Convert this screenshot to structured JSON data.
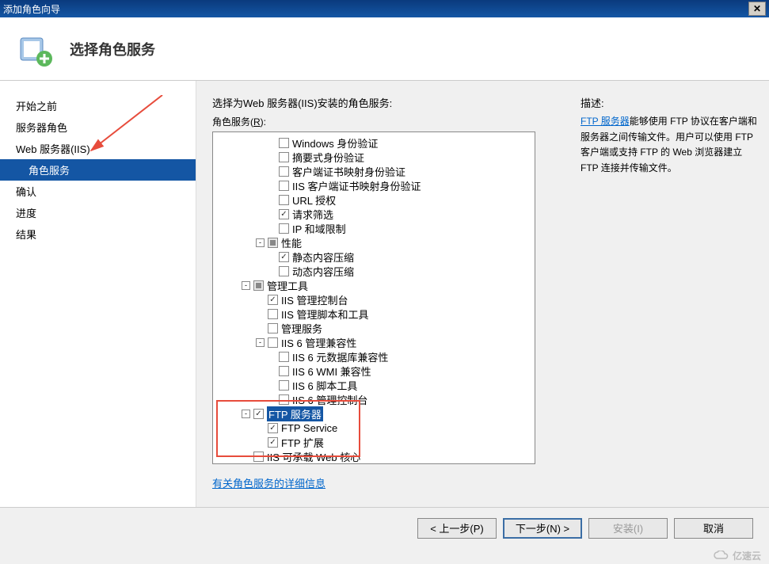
{
  "window": {
    "title": "添加角色向导"
  },
  "header": {
    "title": "选择角色服务"
  },
  "sidebar": {
    "items": [
      {
        "label": "开始之前",
        "indent": false,
        "selected": false
      },
      {
        "label": "服务器角色",
        "indent": false,
        "selected": false
      },
      {
        "label": "Web 服务器(IIS)",
        "indent": false,
        "selected": false
      },
      {
        "label": "角色服务",
        "indent": true,
        "selected": true
      },
      {
        "label": "确认",
        "indent": false,
        "selected": false
      },
      {
        "label": "进度",
        "indent": false,
        "selected": false
      },
      {
        "label": "结果",
        "indent": false,
        "selected": false
      }
    ]
  },
  "main": {
    "instruction": "选择为Web 服务器(IIS)安装的角色服务:",
    "access_label_prefix": "角色服务(",
    "access_key": "R",
    "access_label_suffix": "):",
    "tree": [
      {
        "level": 4,
        "check": "empty",
        "label": "Windows 身份验证"
      },
      {
        "level": 4,
        "check": "empty",
        "label": "摘要式身份验证"
      },
      {
        "level": 4,
        "check": "empty",
        "label": "客户端证书映射身份验证"
      },
      {
        "level": 4,
        "check": "empty",
        "label": "IIS 客户端证书映射身份验证"
      },
      {
        "level": 4,
        "check": "empty",
        "label": "URL 授权"
      },
      {
        "level": 4,
        "check": "checked",
        "label": "请求筛选"
      },
      {
        "level": 4,
        "check": "empty",
        "label": "IP 和域限制"
      },
      {
        "level": 3,
        "expander": "-",
        "check": "partial",
        "label": "性能"
      },
      {
        "level": 4,
        "check": "checked",
        "label": "静态内容压缩"
      },
      {
        "level": 4,
        "check": "empty",
        "label": "动态内容压缩"
      },
      {
        "level": 2,
        "expander": "-",
        "check": "partial",
        "label": "管理工具"
      },
      {
        "level": 3,
        "check": "checked",
        "label": "IIS 管理控制台"
      },
      {
        "level": 3,
        "check": "empty",
        "label": "IIS 管理脚本和工具"
      },
      {
        "level": 3,
        "check": "empty",
        "label": "管理服务"
      },
      {
        "level": 3,
        "expander": "-",
        "check": "empty",
        "label": "IIS 6 管理兼容性"
      },
      {
        "level": 4,
        "check": "empty",
        "label": "IIS 6 元数据库兼容性"
      },
      {
        "level": 4,
        "check": "empty",
        "label": "IIS 6 WMI 兼容性"
      },
      {
        "level": 4,
        "check": "empty",
        "label": "IIS 6 脚本工具"
      },
      {
        "level": 4,
        "check": "empty",
        "label": "IIS 6 管理控制台"
      },
      {
        "level": 2,
        "expander": "-",
        "check": "checked",
        "label": "FTP 服务器",
        "selected": true
      },
      {
        "level": 3,
        "check": "checked",
        "label": "FTP Service"
      },
      {
        "level": 3,
        "check": "checked",
        "label": "FTP 扩展"
      },
      {
        "level": 2,
        "check": "empty",
        "label": "IIS 可承载 Web 核心"
      }
    ],
    "more_link": "有关角色服务的详细信息"
  },
  "desc": {
    "title": "描述:",
    "link": "FTP 服务器",
    "text": "能够使用 FTP 协议在客户端和服务器之间传输文件。用户可以使用 FTP 客户端或支持 FTP 的 Web 浏览器建立 FTP 连接并传输文件。"
  },
  "footer": {
    "prev": "< 上一步(P)",
    "next": "下一步(N) >",
    "install": "安装(I)",
    "cancel": "取消"
  },
  "watermark": "亿速云"
}
